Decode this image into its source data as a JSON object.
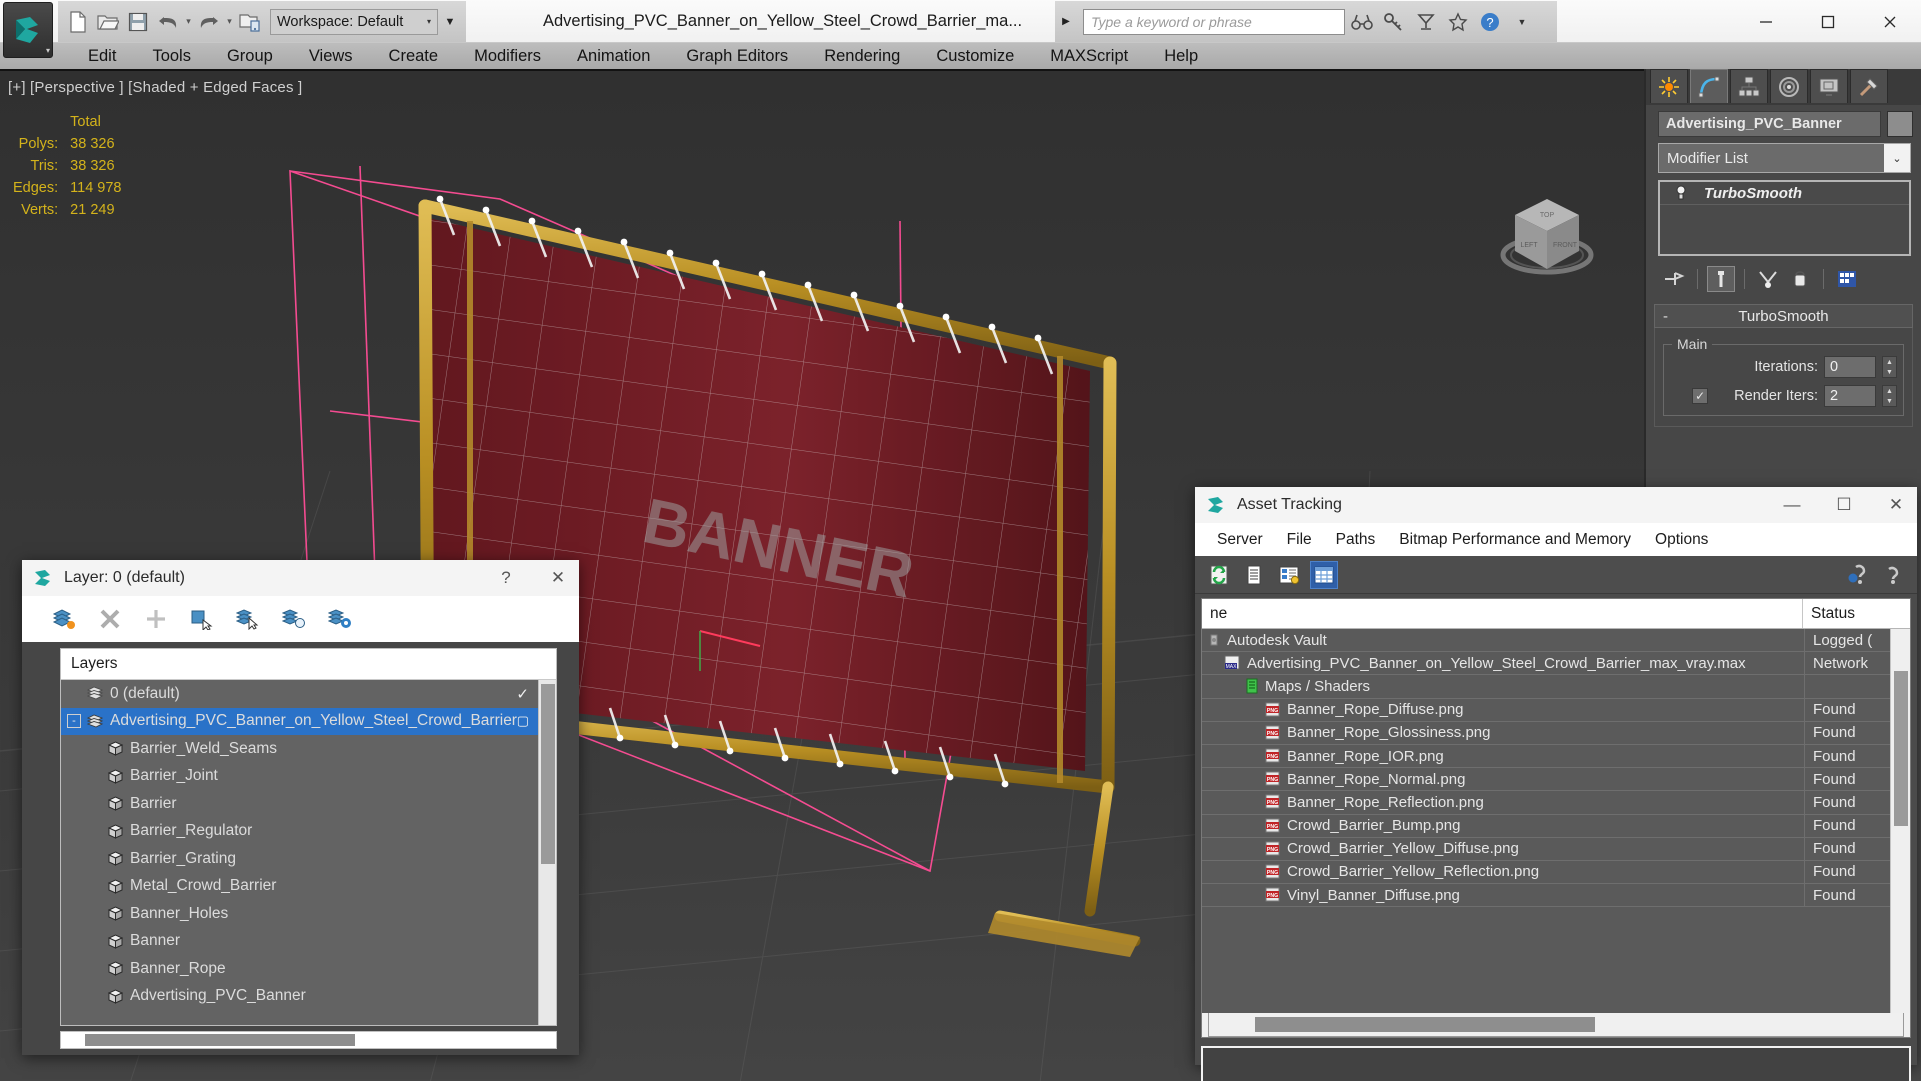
{
  "app": {
    "document_title": "Advertising_PVC_Banner_on_Yellow_Steel_Crowd_Barrier_ma...",
    "workspace": "Workspace: Default",
    "search_placeholder": "Type a keyword or phrase"
  },
  "quick_access": [
    {
      "name": "new-file-icon",
      "label": "New"
    },
    {
      "name": "open-file-icon",
      "label": "Open"
    },
    {
      "name": "save-file-icon",
      "label": "Save"
    },
    {
      "name": "undo-icon",
      "label": "Undo"
    },
    {
      "name": "redo-icon",
      "label": "Redo"
    },
    {
      "name": "project-folder-icon",
      "label": "Set Project Folder"
    }
  ],
  "toolbar_icons": [
    {
      "name": "binoculars-icon",
      "label": "Search"
    },
    {
      "name": "key-icon",
      "label": "Sign In"
    },
    {
      "name": "satellite-dish-icon",
      "label": "Autodesk Exchange"
    },
    {
      "name": "star-icon",
      "label": "Favorites"
    },
    {
      "name": "help-icon",
      "label": "Help"
    }
  ],
  "window_buttons": [
    {
      "name": "minimize-button",
      "glyph": "—"
    },
    {
      "name": "maximize-button",
      "glyph": "☐"
    },
    {
      "name": "close-button",
      "glyph": "✕"
    }
  ],
  "menubar": [
    "Edit",
    "Tools",
    "Group",
    "Views",
    "Create",
    "Modifiers",
    "Animation",
    "Graph Editors",
    "Rendering",
    "Customize",
    "MAXScript",
    "Help"
  ],
  "viewport": {
    "label": "[+] [Perspective ] [Shaded + Edged Faces ]",
    "banner_text": "BANNER",
    "stats": {
      "header": "Total",
      "rows": [
        {
          "label": "Polys:",
          "value": "38 326"
        },
        {
          "label": "Tris:",
          "value": "38 326"
        },
        {
          "label": "Edges:",
          "value": "114 978"
        },
        {
          "label": "Verts:",
          "value": "21 249"
        }
      ]
    },
    "viewcube_faces": {
      "top": "TOP",
      "left": "LEFT",
      "front": "FRONT"
    }
  },
  "command_panel": {
    "tabs": [
      {
        "name": "create-tab",
        "label": "Create"
      },
      {
        "name": "modify-tab",
        "label": "Modify"
      },
      {
        "name": "hierarchy-tab",
        "label": "Hierarchy"
      },
      {
        "name": "motion-tab",
        "label": "Motion"
      },
      {
        "name": "display-tab",
        "label": "Display"
      },
      {
        "name": "utilities-tab",
        "label": "Utilities"
      }
    ],
    "active_tab_index": 1,
    "object_name": "Advertising_PVC_Banner",
    "modifier_list_label": "Modifier List",
    "stack": [
      {
        "name": "TurboSmooth"
      }
    ],
    "rollout": {
      "title": "TurboSmooth",
      "collapse_glyph": "-",
      "group_title": "Main",
      "iterations_label": "Iterations:",
      "iterations_value": "0",
      "render_iters_label": "Render Iters:",
      "render_iters_value": "2",
      "render_iters_checked": true
    }
  },
  "layer_dialog": {
    "title": "Layer: 0 (default)",
    "help_glyph": "?",
    "close_glyph": "✕",
    "toolbar": [
      {
        "name": "set-current-layer-icon"
      },
      {
        "name": "delete-layer-icon"
      },
      {
        "name": "create-new-layer-icon"
      },
      {
        "name": "add-selection-to-layer-icon"
      },
      {
        "name": "select-objects-in-layer-icon"
      },
      {
        "name": "highlight-selected-objects-icon"
      },
      {
        "name": "layer-properties-icon"
      }
    ],
    "column_header": "Layers",
    "rows": [
      {
        "label": "0 (default)",
        "type": "layer",
        "depth": 0,
        "selected": false,
        "current": true,
        "expander": null
      },
      {
        "label": "Advertising_PVC_Banner_on_Yellow_Steel_Crowd_Barrier",
        "type": "layer",
        "depth": 0,
        "selected": true,
        "current": false,
        "expander": "-"
      },
      {
        "label": "Barrier_Weld_Seams",
        "type": "object",
        "depth": 1,
        "selected": false,
        "current": false,
        "expander": null
      },
      {
        "label": "Barrier_Joint",
        "type": "object",
        "depth": 1,
        "selected": false,
        "current": false,
        "expander": null
      },
      {
        "label": "Barrier",
        "type": "object",
        "depth": 1,
        "selected": false,
        "current": false,
        "expander": null
      },
      {
        "label": "Barrier_Regulator",
        "type": "object",
        "depth": 1,
        "selected": false,
        "current": false,
        "expander": null
      },
      {
        "label": "Barrier_Grating",
        "type": "object",
        "depth": 1,
        "selected": false,
        "current": false,
        "expander": null
      },
      {
        "label": "Metal_Crowd_Barrier",
        "type": "object",
        "depth": 1,
        "selected": false,
        "current": false,
        "expander": null
      },
      {
        "label": "Banner_Holes",
        "type": "object",
        "depth": 1,
        "selected": false,
        "current": false,
        "expander": null
      },
      {
        "label": "Banner",
        "type": "object",
        "depth": 1,
        "selected": false,
        "current": false,
        "expander": null
      },
      {
        "label": "Banner_Rope",
        "type": "object",
        "depth": 1,
        "selected": false,
        "current": false,
        "expander": null
      },
      {
        "label": "Advertising_PVC_Banner",
        "type": "object",
        "depth": 1,
        "selected": false,
        "current": false,
        "expander": null
      }
    ]
  },
  "asset_dialog": {
    "title": "Asset Tracking",
    "window_buttons": [
      {
        "name": "minimize-button",
        "glyph": "—"
      },
      {
        "name": "maximize-button",
        "glyph": "☐"
      },
      {
        "name": "close-button",
        "glyph": "✕"
      }
    ],
    "menus": [
      "Server",
      "File",
      "Paths",
      "Bitmap Performance and Memory",
      "Options"
    ],
    "toolbar": [
      {
        "name": "refresh-icon",
        "active": false
      },
      {
        "name": "list-view-icon",
        "active": false
      },
      {
        "name": "details-view-icon",
        "active": false
      },
      {
        "name": "grid-view-icon",
        "active": true
      }
    ],
    "toolbar_right": [
      {
        "name": "help-globe-icon"
      },
      {
        "name": "help-question-icon"
      }
    ],
    "columns": {
      "name": "ne",
      "status": "Status"
    },
    "rows": [
      {
        "name": "Autodesk Vault",
        "status": "Logged (",
        "icon": "vault-icon",
        "depth": 0
      },
      {
        "name": "Advertising_PVC_Banner_on_Yellow_Steel_Crowd_Barrier_max_vray.max",
        "status": "Network",
        "icon": "max-file-icon",
        "depth": 1
      },
      {
        "name": "Maps / Shaders",
        "status": "",
        "icon": "maps-shaders-icon",
        "depth": 2
      },
      {
        "name": "Banner_Rope_Diffuse.png",
        "status": "Found",
        "icon": "png-icon",
        "depth": 3
      },
      {
        "name": "Banner_Rope_Glossiness.png",
        "status": "Found",
        "icon": "png-icon",
        "depth": 3
      },
      {
        "name": "Banner_Rope_IOR.png",
        "status": "Found",
        "icon": "png-icon",
        "depth": 3
      },
      {
        "name": "Banner_Rope_Normal.png",
        "status": "Found",
        "icon": "png-icon",
        "depth": 3
      },
      {
        "name": "Banner_Rope_Reflection.png",
        "status": "Found",
        "icon": "png-icon",
        "depth": 3
      },
      {
        "name": "Crowd_Barrier_Bump.png",
        "status": "Found",
        "icon": "png-icon",
        "depth": 3
      },
      {
        "name": "Crowd_Barrier_Yellow_Diffuse.png",
        "status": "Found",
        "icon": "png-icon",
        "depth": 3
      },
      {
        "name": "Crowd_Barrier_Yellow_Reflection.png",
        "status": "Found",
        "icon": "png-icon",
        "depth": 3
      },
      {
        "name": "Vinyl_Banner_Diffuse.png",
        "status": "Found",
        "icon": "png-icon",
        "depth": 3
      }
    ]
  },
  "colors": {
    "accent_selection": "#2a72c8",
    "viewport_bg": "#333333",
    "stats_text": "#d4b31b",
    "banner_red": "#7d2028",
    "barrier_yellow": "#c9a032",
    "gizmo_pink": "#ff4d96"
  }
}
